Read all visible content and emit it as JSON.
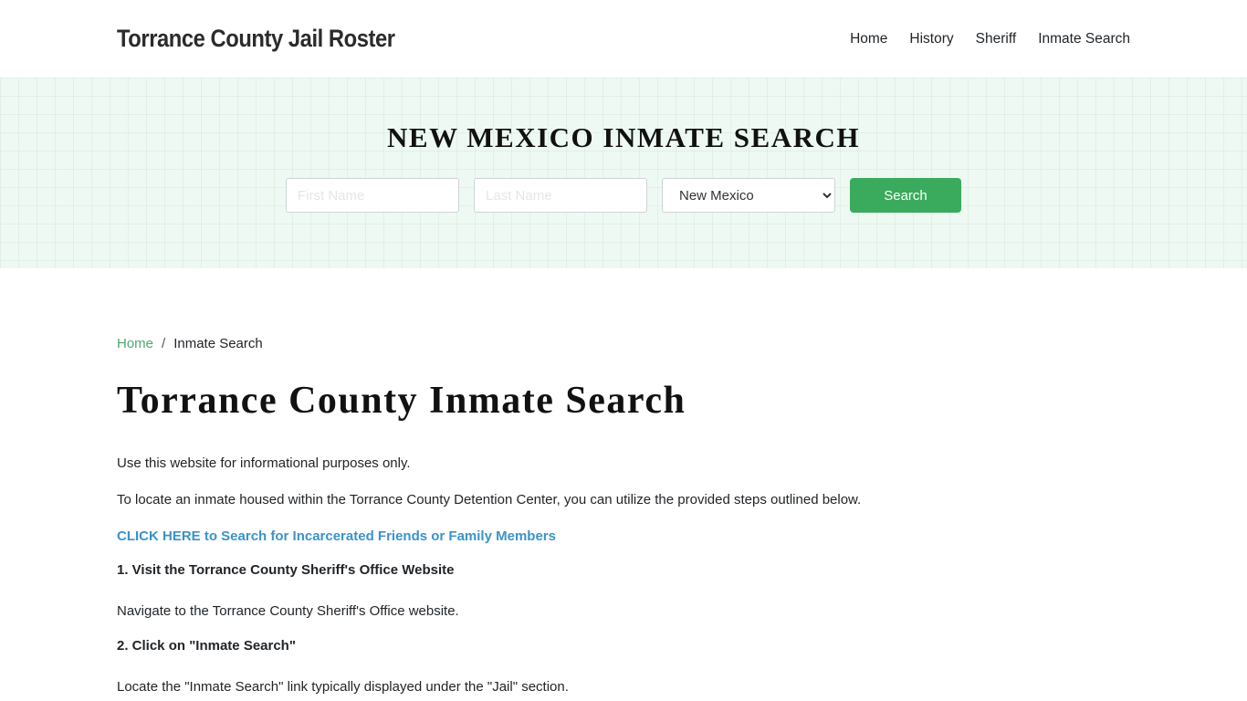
{
  "header": {
    "brand": "Torrance County Jail Roster",
    "nav": [
      {
        "label": "Home"
      },
      {
        "label": "History"
      },
      {
        "label": "Sheriff"
      },
      {
        "label": "Inmate Search"
      }
    ]
  },
  "hero": {
    "title": "NEW MEXICO INMATE SEARCH",
    "first_name_placeholder": "First Name",
    "last_name_placeholder": "Last Name",
    "state_selected": "New Mexico",
    "search_label": "Search",
    "colors": {
      "button": "#3aaa5c",
      "background": "#eef9f3"
    }
  },
  "breadcrumb": {
    "home": "Home",
    "separator": "/",
    "current": "Inmate Search"
  },
  "main": {
    "title": "Torrance County Inmate Search",
    "intro": "Use this website for informational purposes only.",
    "description": "To locate an inmate housed within the Torrance County Detention Center, you can utilize the provided steps outlined below.",
    "cta_link": "CLICK HERE to Search for Incarcerated Friends or Family Members",
    "steps": [
      {
        "title": "1. Visit the Torrance County Sheriff's Office Website",
        "text": "Navigate to the Torrance County Sheriff's Office website."
      },
      {
        "title": "2. Click on \"Inmate Search\"",
        "text": "Locate the \"Inmate Search\" link typically displayed under the \"Jail\" section."
      }
    ]
  }
}
